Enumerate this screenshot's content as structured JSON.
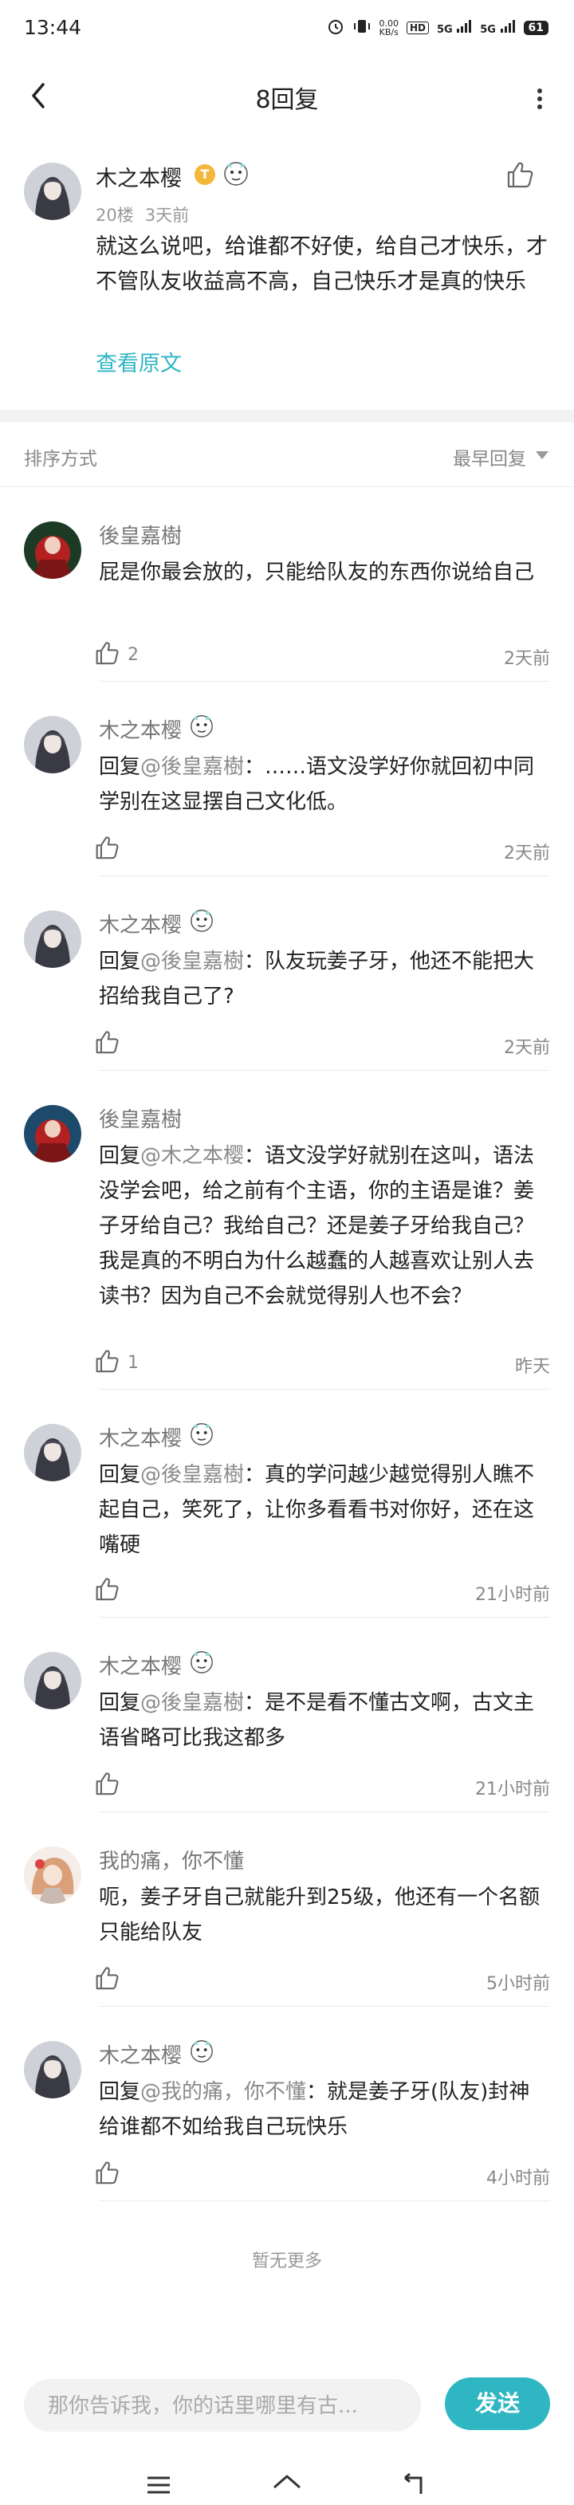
{
  "status": {
    "time": "13:44",
    "speed": "0.00",
    "speed_unit": "KB/s",
    "hd": "HD",
    "net1": "5G",
    "net2": "5G",
    "battery": "61"
  },
  "nav": {
    "title": "8回复"
  },
  "post": {
    "author": "木之本樱",
    "level": "T",
    "floor": "20楼",
    "time": "3天前",
    "text": "就这么说吧，给谁都不好使，给自己才快乐，才不管队友收益高不高，自己快乐才是真的快乐",
    "view_original": "查看原文"
  },
  "sort": {
    "label": "排序方式",
    "value": "最早回复"
  },
  "comments": [
    {
      "author": "後皇嘉樹",
      "prefix": "",
      "mention": "",
      "text": "屁是你最会放的，只能给队友的东西你说给自己",
      "likes": "2",
      "time": "2天前"
    },
    {
      "author": "木之本樱",
      "prefix": "回复",
      "mention": "@後皇嘉樹",
      "text": "：……语文没学好你就回初中同学别在这显摆自己文化低。",
      "likes": "",
      "time": "2天前"
    },
    {
      "author": "木之本樱",
      "prefix": "回复",
      "mention": "@後皇嘉樹",
      "text": "：队友玩姜子牙，他还不能把大招给我自己了?",
      "likes": "",
      "time": "2天前"
    },
    {
      "author": "後皇嘉樹",
      "prefix": "回复",
      "mention": "@木之本樱",
      "text": "：语文没学好就别在这叫，语法没学会吧，给之前有个主语，你的主语是谁？姜子牙给自己？我给自己？还是姜子牙给我自己？我是真的不明白为什么越蠢的人越喜欢让别人去读书？因为自己不会就觉得别人也不会？",
      "likes": "1",
      "time": "昨天"
    },
    {
      "author": "木之本樱",
      "prefix": "回复",
      "mention": "@後皇嘉樹",
      "text": "：真的学问越少越觉得别人瞧不起自己，笑死了，让你多看看书对你好，还在这嘴硬",
      "likes": "",
      "time": "21小时前"
    },
    {
      "author": "木之本樱",
      "prefix": "回复",
      "mention": "@後皇嘉樹",
      "text": "：是不是看不懂古文啊，古文主语省略可比我这都多",
      "likes": "",
      "time": "21小时前"
    },
    {
      "author": "我的痛，你不懂",
      "prefix": "",
      "mention": "",
      "text": "呃，姜子牙自己就能升到25级，他还有一个名额只能给队友",
      "likes": "",
      "time": "5小时前"
    },
    {
      "author": "木之本樱",
      "prefix": "回复",
      "mention": "@我的痛，你不懂",
      "text": "：就是姜子牙(队友)封神给谁都不如给我自己玩快乐",
      "likes": "",
      "time": "4小时前"
    }
  ],
  "no_more": "暂无更多",
  "input": {
    "placeholder": "那你告诉我，你的话里哪里有古...",
    "send": "发送"
  },
  "colors": {
    "accent": "#2fb6c3",
    "separator": "#f2f2f2",
    "meta": "#999999"
  }
}
